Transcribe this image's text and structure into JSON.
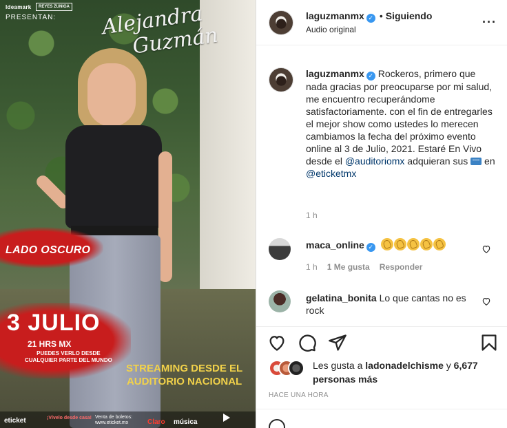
{
  "media": {
    "logo_left": "Ideamark",
    "logo_right": "REYES ZUNIGA",
    "presentan": "PRESENTAN:",
    "script_name_line1": "Alejandra",
    "script_name_line2": "Guzmán",
    "lado_oscuro": "LADO OSCURO",
    "date": "3 JULIO",
    "hours": "21 HRS MX",
    "puedes_line1": "PUEDES VERLO DESDE",
    "puedes_line2": "CUALQUIER PARTE DEL MUNDO",
    "streaming_line1": "STREAMING DESDE EL",
    "streaming_line2": "AUDITORIO NACIONAL",
    "etk": "eticket",
    "vivelo": "¡Vívelo desde casa!",
    "venta_line1": "Venta de boletos:",
    "venta_line2": "www.eticket.mx",
    "claro": "Claro",
    "musica": "música",
    "play_icon": "play-icon"
  },
  "header": {
    "username": "laguzmanmx",
    "verified_icon": "verified-badge-icon",
    "separator": "•",
    "follow_status": "Siguiendo",
    "subtitle": "Audio original",
    "more_icon": "more-options-icon",
    "more_glyph": "···"
  },
  "caption": {
    "username": "laguzmanmx",
    "text_part1": "Rockeros, primero que nada gracias por preocuparse por mi salud, me encuentro recuperándome satisfactoriamente. con el fin de entregarles el mejor show como ustedes lo merecen cambiamos la fecha del próximo evento online al 3 de Julio, 2021. Estaré En Vivo desde el ",
    "mention1": "@auditoriomx",
    "text_part2": " adquieran sus ",
    "ticket_icon": "ticket-emoji",
    "text_part3": " en ",
    "mention2": "@eticketmx",
    "time": "1 h"
  },
  "comments": [
    {
      "username": "maca_online",
      "verified": true,
      "text": "",
      "emoji": "clapping-hands-emoji",
      "emoji_count": 5,
      "time": "1 h",
      "likes": "1 Me gusta",
      "reply": "Responder"
    },
    {
      "username": "gelatina_bonita",
      "text": "Lo que cantas no es rock"
    }
  ],
  "actions": {
    "like_icon": "heart-icon",
    "comment_icon": "comment-icon",
    "share_icon": "share-icon",
    "save_icon": "bookmark-icon"
  },
  "likes": {
    "prefix": "Les gusta a ",
    "user": "ladonadelchisme",
    "middle": " y ",
    "count": "6,677 personas más"
  },
  "time_ago": "HACE UNA HORA"
}
